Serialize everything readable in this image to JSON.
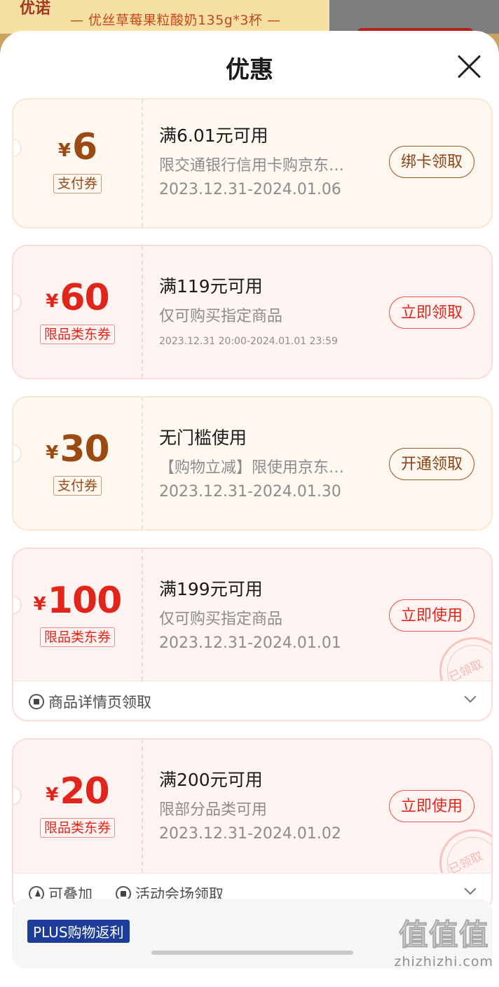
{
  "background": {
    "logo": "优诺",
    "caption": "— 优丝草莓果粒酸奶135g*3杯 —"
  },
  "sheet": {
    "title": "优惠"
  },
  "coupons": [
    {
      "currency": "¥",
      "amount": "6",
      "tag": "支付券",
      "condition": "满6.01元可用",
      "description": "限交通银行信用卡购京东…",
      "date": "2023.12.31-2024.01.06",
      "action": "绑卡领取"
    },
    {
      "currency": "¥",
      "amount": "60",
      "tag": "限品类东券",
      "condition": "满119元可用",
      "description": "仅可购买指定商品",
      "date": "2023.12.31 20:00-2024.01.01 23:59",
      "action": "立即领取"
    },
    {
      "currency": "¥",
      "amount": "30",
      "tag": "支付券",
      "condition": "无门槛使用",
      "description": "【购物立减】限使用京东…",
      "date": "2023.12.31-2024.01.30",
      "action": "开通领取"
    },
    {
      "currency": "¥",
      "amount": "100",
      "tag": "限品类东券",
      "condition": "满199元可用",
      "description": "仅可购买指定商品",
      "date": "2023.12.31-2024.01.01",
      "action": "立即使用",
      "stamp": "已领取",
      "footer": [
        "商品详情页领取"
      ]
    },
    {
      "currency": "¥",
      "amount": "20",
      "tag": "限品类东券",
      "condition": "满200元可用",
      "description": "限部分品类可用",
      "date": "2023.12.31-2024.01.02",
      "action": "立即使用",
      "stamp": "已领取",
      "footer": [
        "可叠加",
        "活动会场领取"
      ]
    }
  ],
  "plus": {
    "badge": "PLUS购物返利"
  },
  "watermark": {
    "big": "值值值",
    "small": "zhizhizhi.com"
  }
}
